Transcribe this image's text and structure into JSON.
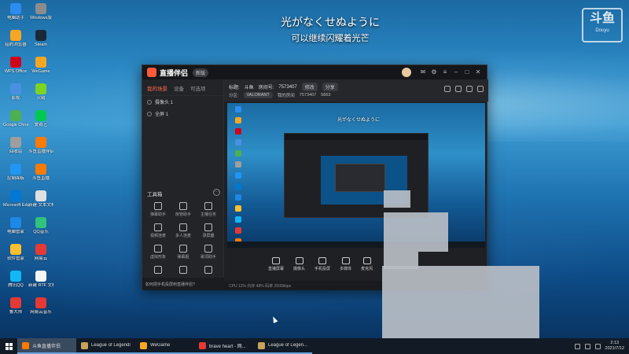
{
  "desktop": {
    "icons": [
      {
        "label": "电脑助手",
        "color": "#2d8cf0"
      },
      {
        "label": "Windows版",
        "color": "#8c8c8c"
      },
      {
        "label": "猎豹浏览器",
        "color": "#f5a623"
      },
      {
        "label": "Steam",
        "color": "#1b2838"
      },
      {
        "label": "WPS Office",
        "color": "#d0021b"
      },
      {
        "label": "WeGame",
        "color": "#f5a623"
      },
      {
        "label": "影视",
        "color": "#4a90e2"
      },
      {
        "label": "火绒",
        "color": "#7ed321"
      },
      {
        "label": "Google Chrome",
        "color": "#4caf50"
      },
      {
        "label": "爱奇艺",
        "color": "#00c853"
      },
      {
        "label": "回收站",
        "color": "#9e9e9e"
      },
      {
        "label": "斗鱼直播伴侣",
        "color": "#ff7a00"
      },
      {
        "label": "控制面板",
        "color": "#2196f3"
      },
      {
        "label": "斗鱼直播",
        "color": "#ff7a00"
      },
      {
        "label": "Microsoft Edge",
        "color": "#0078d4"
      },
      {
        "label": "新建 文本文档",
        "color": "#e0e0e0"
      },
      {
        "label": "电脑管家",
        "color": "#1e88e5"
      },
      {
        "label": "QQ音乐",
        "color": "#31c27c"
      },
      {
        "label": "软件管家",
        "color": "#fbc02d"
      },
      {
        "label": "网易云",
        "color": "#e53935"
      },
      {
        "label": "腾讯QQ",
        "color": "#12b7f5"
      },
      {
        "label": "新建 RTF 文档",
        "color": "#f5f5f5"
      },
      {
        "label": "鲁大师",
        "color": "#e53935"
      },
      {
        "label": "网易云音乐",
        "color": "#e53935"
      }
    ]
  },
  "subtitle": {
    "line1": "光がなくせぬように",
    "line2": "可以继续闪耀着光芒"
  },
  "watermark": {
    "big": "斗鱼",
    "small": "Douyu"
  },
  "app": {
    "name": "直播伴侣",
    "version": "新版",
    "left_tabs": [
      "我的场景",
      "设备",
      "可选项"
    ],
    "scenes": [
      "摄像头 1",
      "全屏 1"
    ],
    "tools_title": "工具箱",
    "tools": [
      "弹幕助手",
      "房管助手",
      "主播任务",
      "视频连麦",
      "多人连麦",
      "录屏器",
      "虚拟形象",
      "弹幕姬",
      "歌词助手",
      "",
      "",
      ""
    ],
    "bottom_tip": "如何把手机投屏到直播伴侣?",
    "room": {
      "title_label": "标题:",
      "title": "斗鱼",
      "room_label": "房间号:",
      "room_id": "7573407",
      "btn_edit": "修改",
      "btn_share": "分享",
      "category_label": "分区:",
      "category": "VALORANT",
      "room_no_label": "我的房间",
      "room_no": "7573407",
      "viewers": "5863"
    },
    "toolbar": [
      "直播屏幕",
      "摄像头",
      "手机投屏",
      "多媒体",
      "麦克风"
    ],
    "status_text": "CPU 12%   内存 48%   码率 2500kbps"
  },
  "preview": {
    "sub": "光がなくせぬように"
  },
  "taskbar": {
    "items": [
      {
        "label": "斗鱼直播伴侣",
        "color": "#ff7a00",
        "active": true
      },
      {
        "label": "League of Legends",
        "color": "#c8a25a",
        "active": false
      },
      {
        "label": "WeGame",
        "color": "#f5a623",
        "active": false
      },
      {
        "label": "brave heart - 网...",
        "color": "#e53935",
        "active": false
      },
      {
        "label": "League of Legen...",
        "color": "#c8a25a",
        "active": false
      }
    ],
    "time": "2:13",
    "date": "2021/7/12"
  }
}
